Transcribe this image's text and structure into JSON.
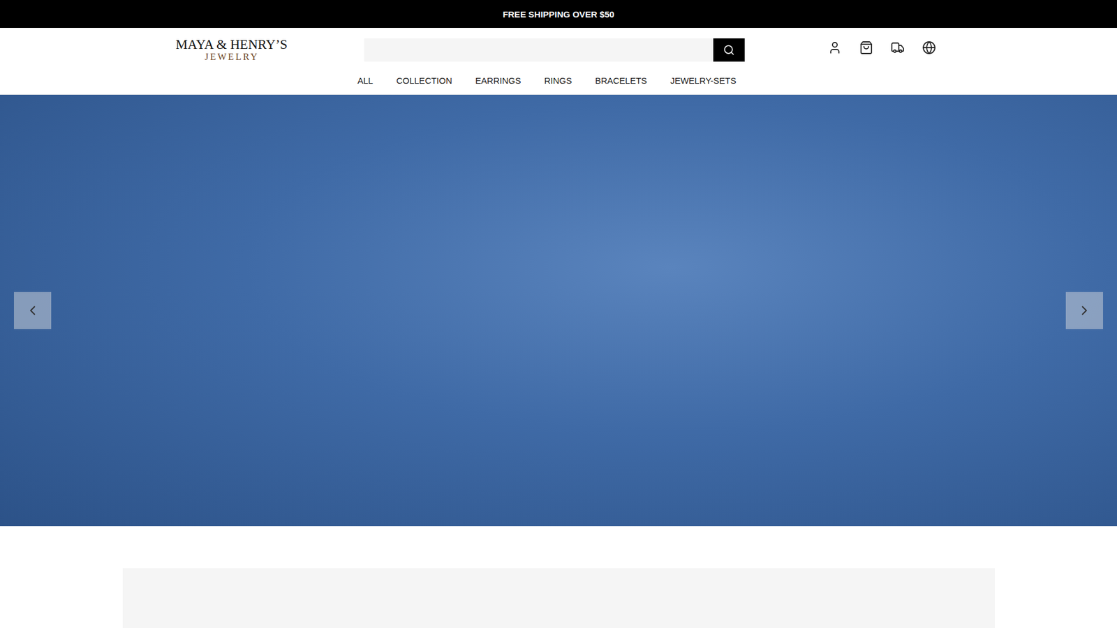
{
  "announcement": "FREE SHIPPING OVER $50",
  "logo": {
    "line1": "MAYA & HENRY’S",
    "line2": "JEWELRY"
  },
  "search": {
    "placeholder": ""
  },
  "nav": [
    {
      "label": "ALL"
    },
    {
      "label": "COLLECTION"
    },
    {
      "label": "EARRINGS"
    },
    {
      "label": "RINGS"
    },
    {
      "label": "BRACELETS"
    },
    {
      "label": "JEWELRY-SETS"
    }
  ]
}
